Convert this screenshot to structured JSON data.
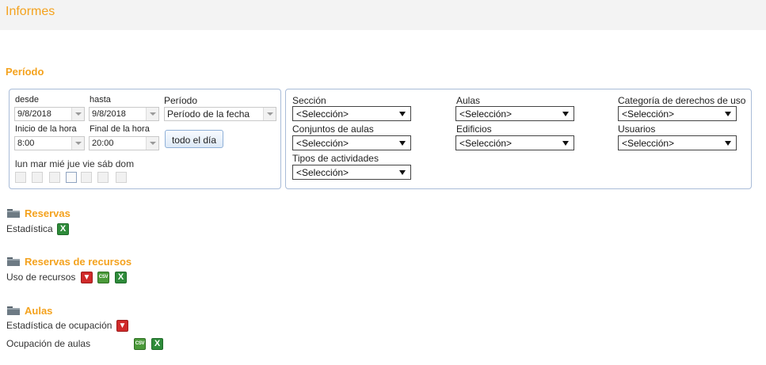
{
  "header": {
    "title": "Informes"
  },
  "period": {
    "title": "Período",
    "from": {
      "label": "desde",
      "value": "9/8/2018"
    },
    "to": {
      "label": "hasta",
      "value": "9/8/2018"
    },
    "period_select": {
      "label": "Período",
      "value": "Período de la fecha"
    },
    "start_time": {
      "label": "Inicio de la hora",
      "value": "8:00"
    },
    "end_time": {
      "label": "Final de la hora",
      "value": "20:00"
    },
    "all_day_button": "todo el día",
    "weekdays_label": "lun mar mié jue vie sáb dom"
  },
  "filters": {
    "seccion": {
      "label": "Sección",
      "value": "<Selección>"
    },
    "aulas": {
      "label": "Aulas",
      "value": "<Selección>"
    },
    "categoria": {
      "label": "Categoría de derechos de uso",
      "value": "<Selección>"
    },
    "conjuntos": {
      "label": "Conjuntos de aulas",
      "value": "<Selección>"
    },
    "edificios": {
      "label": "Edificios",
      "value": "<Selección>"
    },
    "usuarios": {
      "label": "Usuarios",
      "value": "<Selección>"
    },
    "tipos": {
      "label": "Tipos de actividades",
      "value": "<Selección>"
    }
  },
  "reports": {
    "reservas": {
      "title": "Reservas",
      "items": [
        {
          "label": "Estadística"
        }
      ]
    },
    "recursos": {
      "title": "Reservas de recursos",
      "items": [
        {
          "label": "Uso de recursos"
        }
      ]
    },
    "aulas": {
      "title": "Aulas",
      "items": [
        {
          "label": "Estadística de ocupación"
        },
        {
          "label": "Ocupación de aulas"
        }
      ]
    }
  },
  "icons": {
    "excel": "X",
    "pdf": "pdf-icon",
    "csv": "CSV"
  },
  "colors": {
    "accent": "#f4a21d",
    "panel_border": "#a9bcd8",
    "excel": "#2e8b3a",
    "pdf": "#d02a2a"
  }
}
